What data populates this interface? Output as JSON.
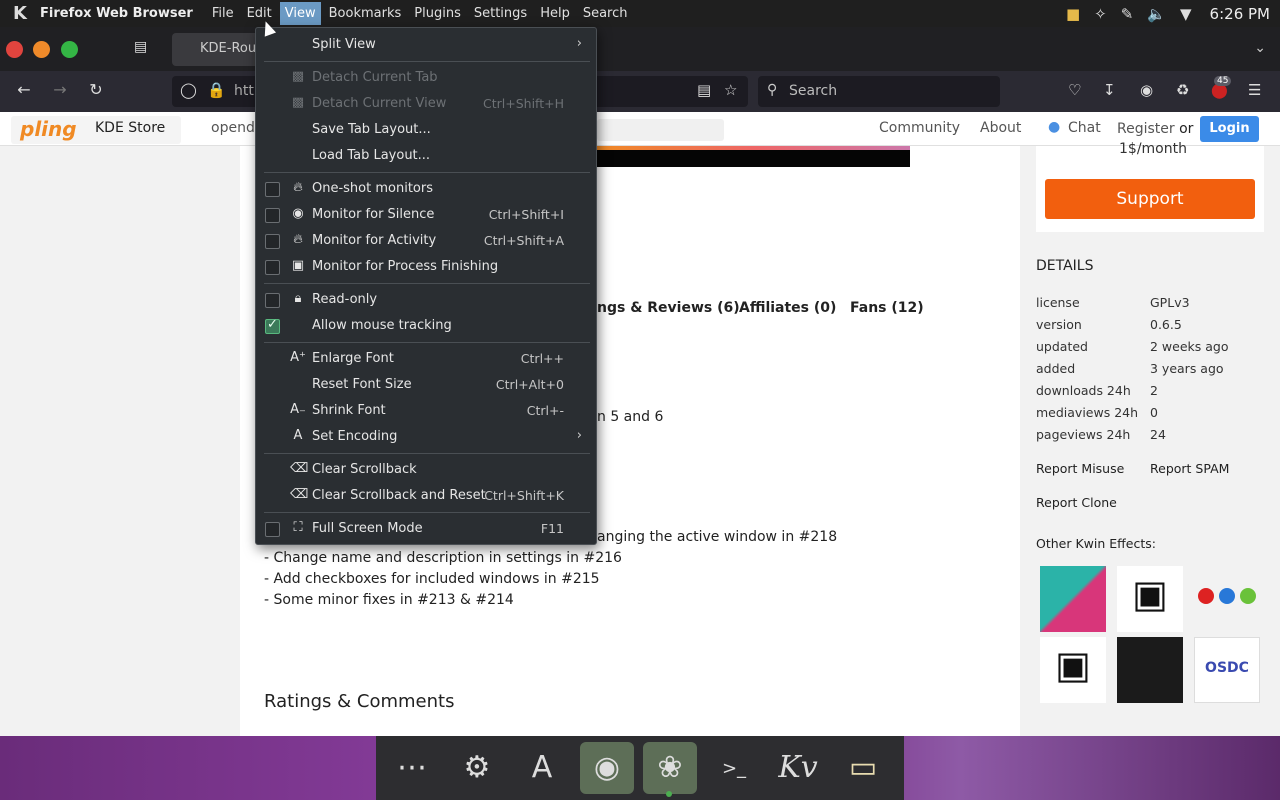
{
  "panel": {
    "logo": "K",
    "app_name": "Firefox Web Browser",
    "menus": [
      "File",
      "Edit",
      "View",
      "Bookmarks",
      "Plugins",
      "Settings",
      "Help",
      "Search"
    ],
    "clock": "6:26 PM"
  },
  "tabs": {
    "active_title": "KDE-Rou"
  },
  "urlbar": {
    "url_prefix": "htt"
  },
  "searchbar": {
    "placeholder": "Search"
  },
  "extensions_badge": "45",
  "site": {
    "logo_text": "pling",
    "store_name": "KDE Store",
    "search_text": "opende",
    "nav": {
      "community": "Community",
      "about": "About",
      "chat": "Chat"
    },
    "register": "Register",
    "or": "or",
    "login": "Login"
  },
  "content": {
    "tabs": [
      "ngs & Reviews (6)",
      "Affiliates (0)",
      "Fans (12)"
    ],
    "desc_fragment": "n 5 and 6",
    "changelog_first_tail": "anging the active window in #218",
    "changelog": [
      "- Change name and description in settings in #216",
      "- Add checkboxes for included windows in #215",
      "- Some minor fixes in #213 & #214"
    ],
    "ratings_heading": "Ratings & Comments"
  },
  "sidebar": {
    "price": "1$/month",
    "support": "Support",
    "details_heading": "DETAILS",
    "details": [
      {
        "label": "license",
        "value": "GPLv3"
      },
      {
        "label": "version",
        "value": "0.6.5"
      },
      {
        "label": "updated",
        "value": "2 weeks ago"
      },
      {
        "label": "added",
        "value": "3 years ago"
      },
      {
        "label": "downloads 24h",
        "value": "2"
      },
      {
        "label": "mediaviews 24h",
        "value": "0"
      },
      {
        "label": "pageviews 24h",
        "value": "24"
      }
    ],
    "report_misuse": "Report Misuse",
    "report_spam": "Report SPAM",
    "report_clone": "Report Clone",
    "other_effects": "Other Kwin Effects:",
    "osdc": "OSDC"
  },
  "view_menu": {
    "items": [
      {
        "label": "Split View",
        "shortcut": "",
        "submenu": true
      },
      {
        "label": "Detach Current Tab",
        "shortcut": "",
        "disabled": true
      },
      {
        "label": "Detach Current View",
        "shortcut": "Ctrl+Shift+H",
        "disabled": true
      },
      {
        "label": "Save Tab Layout...",
        "shortcut": ""
      },
      {
        "label": "Load Tab Layout...",
        "shortcut": ""
      },
      {
        "label": "One-shot monitors",
        "shortcut": "",
        "checked": false
      },
      {
        "label": "Monitor for Silence",
        "shortcut": "Ctrl+Shift+I",
        "checked": false
      },
      {
        "label": "Monitor for Activity",
        "shortcut": "Ctrl+Shift+A",
        "checked": false
      },
      {
        "label": "Monitor for Process Finishing",
        "shortcut": "",
        "checked": false
      },
      {
        "label": "Read-only",
        "shortcut": "",
        "checked": false
      },
      {
        "label": "Allow mouse tracking",
        "shortcut": "",
        "checked": true
      },
      {
        "label": "Enlarge Font",
        "shortcut": "Ctrl++"
      },
      {
        "label": "Reset Font Size",
        "shortcut": "Ctrl+Alt+0"
      },
      {
        "label": "Shrink Font",
        "shortcut": "Ctrl+-"
      },
      {
        "label": "Set Encoding",
        "shortcut": "",
        "submenu": true
      },
      {
        "label": "Clear Scrollback",
        "shortcut": ""
      },
      {
        "label": "Clear Scrollback and Reset",
        "shortcut": "Ctrl+Shift+K"
      },
      {
        "label": "Full Screen Mode",
        "shortcut": "F11",
        "checked": false
      }
    ]
  },
  "colors": {
    "menu_highlight": "#6b9ac4",
    "support_button": "#f25f0e",
    "login_button": "#3b8be8"
  }
}
